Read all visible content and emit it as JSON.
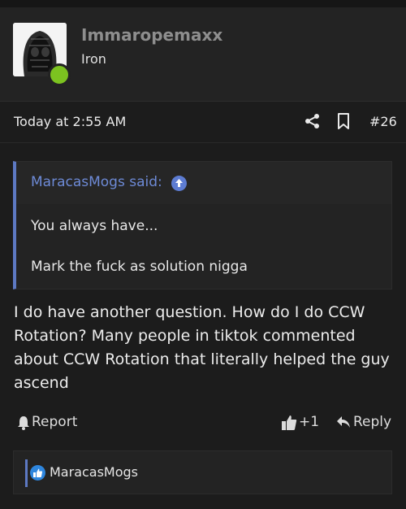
{
  "user": {
    "username": "Immaropemaxx",
    "rank": "Iron"
  },
  "post": {
    "date": "Today at 2:55 AM",
    "number": "#26",
    "body": "I do have another question. How do I do CCW Rotation? Many people in tiktok commented about CCW Rotation that literally helped the guy ascend"
  },
  "quote": {
    "author": "MaracasMogs said:",
    "line1": "You always have...",
    "line2": "Mark the fuck as solution nigga"
  },
  "actions": {
    "report_label": "Report",
    "like_label": "+1",
    "reply_label": "Reply"
  },
  "reactions": {
    "name": "MaracasMogs"
  },
  "icons": {
    "share": "share-icon",
    "bookmark": "bookmark-icon",
    "report": "bell-icon",
    "like": "thumbs-up-icon",
    "reply": "reply-arrow-icon",
    "quote_link": "arrow-up-circle-icon"
  },
  "colors": {
    "accent": "#5d79c3",
    "online": "#7cc320",
    "background": "#1c1c1c"
  }
}
